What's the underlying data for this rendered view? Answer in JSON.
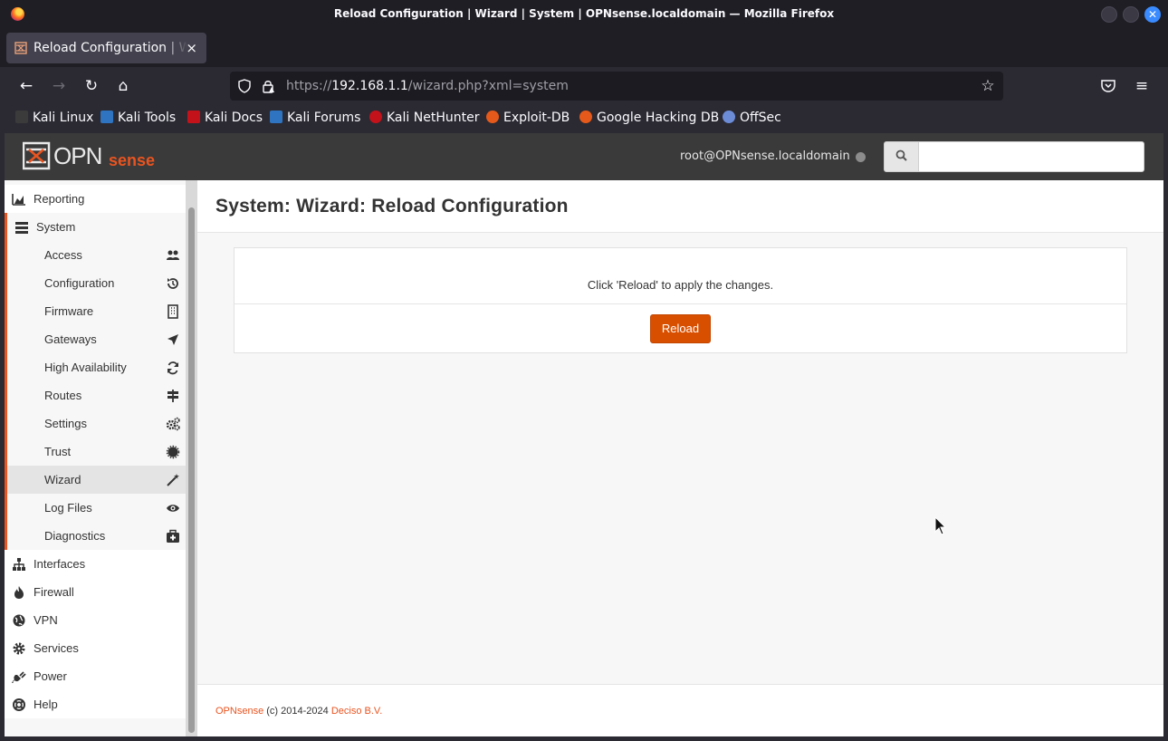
{
  "window": {
    "title": "Reload Configuration | Wizard | System | OPNsense.localdomain — Mozilla Firefox"
  },
  "tab": {
    "label": "Reload Configuration | Wizard | System",
    "close": "×"
  },
  "newtab": "+",
  "nav": {
    "back": "←",
    "forward": "→",
    "reload": "↻",
    "home": "⌂",
    "url_prefix": "https://",
    "url_host": "192.168.1.1",
    "url_path": "/wizard.php?xml=system",
    "star": "☆",
    "pocket": "◡",
    "menu": "≡"
  },
  "bookmarks": [
    {
      "label": "Kali Linux",
      "color": "#3b3b3b"
    },
    {
      "label": "Kali Tools",
      "color": "#2f74c0"
    },
    {
      "label": "Kali Docs",
      "color": "#c4121b"
    },
    {
      "label": "Kali Forums",
      "color": "#2f74c0"
    },
    {
      "label": "Kali NetHunter",
      "color": "#c4121b"
    },
    {
      "label": "Exploit-DB",
      "color": "#e55a1a"
    },
    {
      "label": "Google Hacking DB",
      "color": "#e55a1a"
    },
    {
      "label": "OffSec",
      "color": "#6c8cd8"
    }
  ],
  "header": {
    "user": "root@OPNsense.localdomain",
    "search_placeholder": "",
    "search_icon": "🔍"
  },
  "menu": {
    "top": [
      {
        "label": "Reporting",
        "icon": "area-chart-icon",
        "glyph": "▲"
      }
    ],
    "system": {
      "label": "System",
      "icon": "server-icon",
      "glyph": "☰"
    },
    "system_items": [
      {
        "label": "Access",
        "glyph": "👥"
      },
      {
        "label": "Configuration",
        "glyph": "↺"
      },
      {
        "label": "Firmware",
        "glyph": "▦"
      },
      {
        "label": "Gateways",
        "glyph": "➤"
      },
      {
        "label": "High Availability",
        "glyph": "⟳"
      },
      {
        "label": "Routes",
        "glyph": "⊤"
      },
      {
        "label": "Settings",
        "glyph": "⚙"
      },
      {
        "label": "Trust",
        "glyph": "✹"
      },
      {
        "label": "Wizard",
        "glyph": "⚡"
      },
      {
        "label": "Log Files",
        "glyph": "👁"
      },
      {
        "label": "Diagnostics",
        "glyph": "⊞"
      }
    ],
    "bottom": [
      {
        "label": "Interfaces",
        "glyph": "⚇"
      },
      {
        "label": "Firewall",
        "glyph": "♨"
      },
      {
        "label": "VPN",
        "glyph": "◉"
      },
      {
        "label": "Services",
        "glyph": "⚙"
      },
      {
        "label": "Power",
        "glyph": "⚡"
      },
      {
        "label": "Help",
        "glyph": "◎"
      }
    ]
  },
  "content": {
    "title": "System: Wizard: Reload Configuration",
    "message": "Click 'Reload' to apply the changes.",
    "button": "Reload"
  },
  "footer": {
    "brand": "OPNsense",
    "copyright": " (c) 2014-2024 ",
    "company": "Deciso B.V."
  },
  "colors": {
    "accent": "#e95420",
    "button": "#d94f00",
    "header": "#3a3a3a"
  }
}
